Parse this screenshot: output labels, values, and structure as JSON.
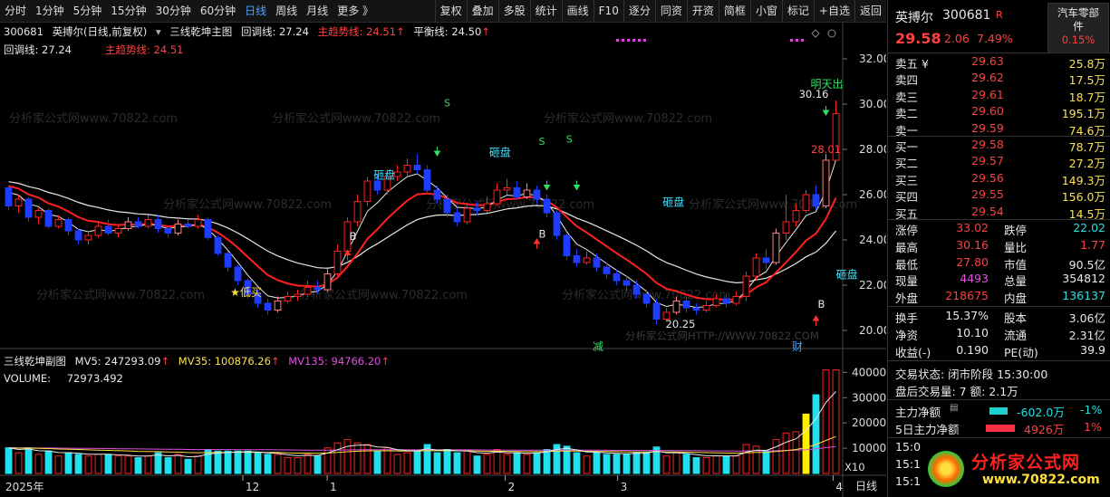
{
  "toolbar": {
    "periods": [
      "分时",
      "1分钟",
      "5分钟",
      "15分钟",
      "30分钟",
      "60分钟",
      "日线",
      "周线",
      "月线",
      "更多 》"
    ],
    "active_period": "日线",
    "actions": [
      "复权",
      "叠加",
      "多股",
      "统计",
      "画线",
      "F10",
      "逐分",
      "同资",
      "开资",
      "简框",
      "小窗",
      "标记",
      "+自选",
      "返回"
    ]
  },
  "main_legend": {
    "code": "300681",
    "name_mode": "英搏尔(日线,前复权)",
    "indicator": "三线乾坤主图",
    "huitiao": "回调线: 27.24",
    "zhuqushi": "主趋势线: 24.51",
    "pinghengxian": "平衡线: 24.50",
    "line2_huitiao": "回调线: 27.24",
    "line2_zhuqushi": "主趋势线: 24.51"
  },
  "price_axis": [
    "32.00",
    "30.00",
    "28.00",
    "26.00",
    "24.00",
    "22.00",
    "20.00"
  ],
  "annotations": {
    "high": "30.16",
    "low": "20.25",
    "close_label": "28.01",
    "mingtian": "明天出",
    "dimai": "★低买",
    "zapan": "砸盘",
    "s": "S",
    "b": "B",
    "jian": "减",
    "cai": "财"
  },
  "watermark": "分析家公式网www.70822.com",
  "watermark_lower": "分析家公式网HTTP://WWW.70822.COM",
  "sub_legend": {
    "title": "三线乾坤副图",
    "mv5": "MV5: 247293.09",
    "mv35": "MV35: 100876.26",
    "mv135": "MV135: 94766.20",
    "volume": "VOLUME:",
    "volume_val": "72973.492"
  },
  "vol_axis": [
    "40000",
    "30000",
    "20000",
    "10000"
  ],
  "vol_unit": "X10",
  "date_axis": [
    "2025年",
    "12",
    "1",
    "2",
    "3",
    "4"
  ],
  "period_label": "日线",
  "right_panel": {
    "name": "英搏尔",
    "code": "300681",
    "badge": "R",
    "sector_line1": "汽车零部",
    "sector_line2": "件",
    "sector_pct": "0.15%",
    "price": "29.58",
    "change": "2.06",
    "pct": "7.49%",
    "asks": [
      {
        "label": "卖五 ¥",
        "price": "29.63",
        "vol": "25.8万"
      },
      {
        "label": "卖四",
        "price": "29.62",
        "vol": "17.5万"
      },
      {
        "label": "卖三",
        "price": "29.61",
        "vol": "18.7万"
      },
      {
        "label": "卖二",
        "price": "29.60",
        "vol": "195.1万"
      },
      {
        "label": "卖一",
        "price": "29.59",
        "vol": "74.6万"
      }
    ],
    "bids": [
      {
        "label": "买一",
        "price": "29.58",
        "vol": "78.7万"
      },
      {
        "label": "买二",
        "price": "29.57",
        "vol": "27.2万"
      },
      {
        "label": "买三",
        "price": "29.56",
        "vol": "149.3万"
      },
      {
        "label": "买四",
        "price": "29.55",
        "vol": "156.0万"
      },
      {
        "label": "买五",
        "price": "29.54",
        "vol": "14.5万"
      }
    ],
    "stats": [
      {
        "k1": "涨停",
        "v1": "33.02",
        "k2": "跌停",
        "v2": "22.02"
      },
      {
        "k1": "最高",
        "v1": "30.16",
        "k2": "量比",
        "v2": "1.77"
      },
      {
        "k1": "最低",
        "v1": "27.80",
        "k2": "市值",
        "v2": "90.5亿"
      },
      {
        "k1": "现量",
        "v1": "4493",
        "k2": "总量",
        "v2": "354812"
      },
      {
        "k1": "外盘",
        "v1": "218675",
        "k2": "内盘",
        "v2": "136137"
      }
    ],
    "stats2": [
      {
        "k1": "换手",
        "v1": "15.37%",
        "k2": "股本",
        "v2": "3.06亿"
      },
      {
        "k1": "净资",
        "v1": "10.10",
        "k2": "流通",
        "v2": "2.31亿"
      },
      {
        "k1": "收益(-)",
        "v1": "0.190",
        "k2": "PE(动)",
        "v2": "39.9"
      }
    ],
    "trade_status": "交易状态: 闭市阶段 15:30:00",
    "after_trade": "盘后交易量: 7  额: 2.1万",
    "main_net_label": "主力净额",
    "main_net_val": "-602.0万",
    "main_net_pct": "-1%",
    "main_net5_label": "5日主力净额",
    "main_net5_val": "4926万",
    "main_net5_pct": "1%",
    "ticks": [
      "15:0",
      "15:1",
      "15:1"
    ],
    "logo_text": "分析家公式网",
    "logo_url": "www.70822.com"
  },
  "chart_data": {
    "type": "candlestick",
    "ylim": [
      19.4,
      32.8
    ],
    "candles": [
      [
        26.3,
        25.5,
        26.4,
        25.3
      ],
      [
        25.5,
        25.8,
        26.0,
        25.2
      ],
      [
        25.8,
        25.0,
        25.9,
        24.8
      ],
      [
        25.0,
        25.3,
        25.4,
        24.7
      ],
      [
        25.3,
        24.6,
        25.4,
        24.5
      ],
      [
        24.6,
        24.9,
        25.1,
        24.5
      ],
      [
        24.9,
        24.4,
        25.0,
        24.2
      ],
      [
        24.4,
        24.0,
        24.5,
        23.8
      ],
      [
        24.0,
        24.2,
        24.4,
        23.8
      ],
      [
        24.2,
        24.6,
        24.8,
        24.1
      ],
      [
        24.6,
        24.3,
        24.9,
        24.2
      ],
      [
        24.3,
        24.5,
        24.7,
        24.1
      ],
      [
        24.5,
        24.8,
        25.0,
        24.4
      ],
      [
        24.8,
        24.6,
        25.0,
        24.5
      ],
      [
        24.6,
        24.9,
        25.1,
        24.5
      ],
      [
        24.9,
        24.5,
        25.1,
        24.3
      ],
      [
        24.5,
        24.3,
        24.6,
        24.1
      ],
      [
        24.3,
        24.7,
        24.9,
        24.2
      ],
      [
        24.7,
        24.6,
        24.9,
        24.5
      ],
      [
        24.6,
        24.9,
        25.1,
        24.5
      ],
      [
        24.9,
        24.1,
        25.0,
        24.0
      ],
      [
        24.1,
        23.4,
        24.2,
        23.3
      ],
      [
        23.4,
        22.8,
        23.5,
        22.6
      ],
      [
        22.8,
        22.2,
        22.9,
        22.0
      ],
      [
        22.2,
        21.6,
        22.3,
        21.4
      ],
      [
        21.6,
        21.2,
        21.8,
        21.0
      ],
      [
        21.2,
        20.9,
        21.4,
        20.7
      ],
      [
        20.9,
        21.3,
        21.5,
        20.8
      ],
      [
        21.3,
        21.5,
        21.7,
        21.2
      ],
      [
        21.5,
        21.6,
        21.8,
        21.3
      ],
      [
        21.6,
        21.9,
        22.2,
        21.5
      ],
      [
        21.9,
        21.8,
        22.2,
        21.6
      ],
      [
        21.8,
        22.5,
        22.8,
        21.7
      ],
      [
        22.5,
        23.5,
        23.8,
        22.4
      ],
      [
        23.5,
        24.8,
        25.0,
        23.4
      ],
      [
        24.8,
        25.7,
        26.0,
        24.6
      ],
      [
        25.7,
        26.6,
        26.8,
        25.5
      ],
      [
        26.6,
        26.2,
        26.9,
        26.0
      ],
      [
        26.2,
        26.8,
        27.1,
        26.0
      ],
      [
        26.8,
        27.0,
        27.3,
        26.6
      ],
      [
        27.0,
        27.3,
        27.6,
        26.8
      ],
      [
        27.3,
        27.1,
        27.8,
        26.9
      ],
      [
        27.1,
        26.2,
        27.3,
        26.0
      ],
      [
        26.2,
        25.8,
        26.4,
        25.6
      ],
      [
        25.8,
        25.2,
        26.0,
        25.0
      ],
      [
        25.2,
        24.8,
        25.4,
        24.6
      ],
      [
        24.8,
        25.4,
        25.6,
        24.7
      ],
      [
        25.4,
        25.3,
        25.7,
        25.1
      ],
      [
        25.3,
        25.6,
        25.9,
        25.2
      ],
      [
        25.6,
        26.2,
        26.5,
        25.5
      ],
      [
        26.2,
        26.3,
        26.7,
        26.0
      ],
      [
        26.3,
        25.9,
        26.6,
        25.8
      ],
      [
        25.9,
        26.2,
        26.5,
        25.8
      ],
      [
        26.2,
        25.8,
        26.4,
        25.6
      ],
      [
        25.8,
        25.2,
        26.0,
        25.0
      ],
      [
        25.2,
        24.2,
        25.3,
        24.0
      ],
      [
        24.2,
        23.3,
        24.3,
        23.1
      ],
      [
        23.3,
        23.0,
        23.6,
        22.8
      ],
      [
        23.0,
        23.2,
        23.5,
        22.9
      ],
      [
        23.2,
        22.8,
        23.4,
        22.6
      ],
      [
        22.8,
        22.5,
        23.0,
        22.3
      ],
      [
        22.5,
        22.2,
        22.7,
        22.0
      ],
      [
        22.2,
        22.0,
        22.4,
        21.7
      ],
      [
        22.0,
        21.6,
        22.2,
        21.4
      ],
      [
        21.6,
        21.2,
        21.8,
        21.0
      ],
      [
        21.2,
        20.5,
        21.4,
        20.25
      ],
      [
        20.5,
        20.8,
        21.0,
        20.4
      ],
      [
        20.8,
        21.3,
        21.5,
        20.7
      ],
      [
        21.3,
        21.0,
        21.5,
        20.8
      ],
      [
        21.0,
        20.9,
        21.2,
        20.7
      ],
      [
        20.9,
        21.1,
        21.3,
        20.8
      ],
      [
        21.1,
        21.4,
        21.6,
        21.0
      ],
      [
        21.4,
        21.2,
        21.6,
        21.0
      ],
      [
        21.2,
        21.5,
        21.7,
        21.1
      ],
      [
        21.5,
        22.4,
        22.6,
        21.3
      ],
      [
        22.4,
        23.2,
        23.4,
        22.2
      ],
      [
        23.2,
        23.0,
        23.6,
        22.7
      ],
      [
        23.0,
        24.3,
        24.5,
        22.9
      ],
      [
        24.3,
        24.8,
        26.0,
        24.0
      ],
      [
        24.8,
        25.3,
        25.6,
        24.6
      ],
      [
        25.3,
        26.0,
        26.2,
        25.2
      ],
      [
        26.0,
        25.5,
        26.4,
        25.3
      ],
      [
        25.5,
        27.52,
        27.8,
        25.4
      ],
      [
        27.52,
        29.58,
        30.16,
        27.8
      ]
    ],
    "volume_ylim": [
      0,
      43000
    ]
  }
}
